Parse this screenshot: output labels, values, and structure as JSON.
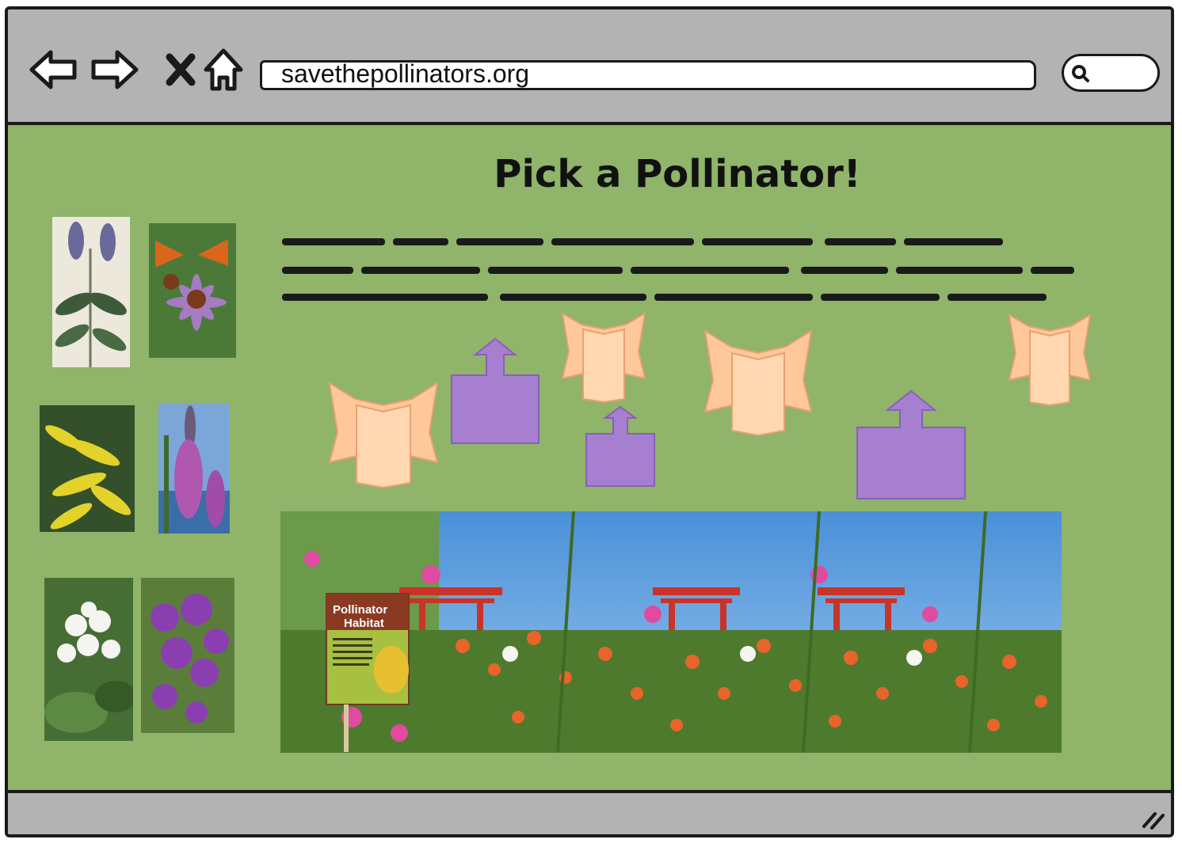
{
  "browser": {
    "url": "savethepollinators.org",
    "nav_icons": [
      "back-arrow-icon",
      "forward-arrow-icon",
      "close-x-icon",
      "home-icon"
    ],
    "search_icon": "magnifier-icon"
  },
  "page": {
    "title": "Pick a Pollinator!",
    "background_color": "#8fb46a"
  },
  "flower_gallery": {
    "photos": [
      "flower-photo-1",
      "flower-photo-2",
      "flower-photo-3",
      "flower-photo-4",
      "flower-photo-5",
      "flower-photo-6"
    ]
  },
  "banner": {
    "sign_title": "Pollinator Habitat",
    "sign_title_line1": "Pollinator",
    "sign_title_line2": "Habitat"
  },
  "colors": {
    "chrome": "#b3b3b3",
    "border": "#1a1a1a",
    "placeholder_peach": "#ffc89a",
    "placeholder_purple": "#a67fd0"
  }
}
